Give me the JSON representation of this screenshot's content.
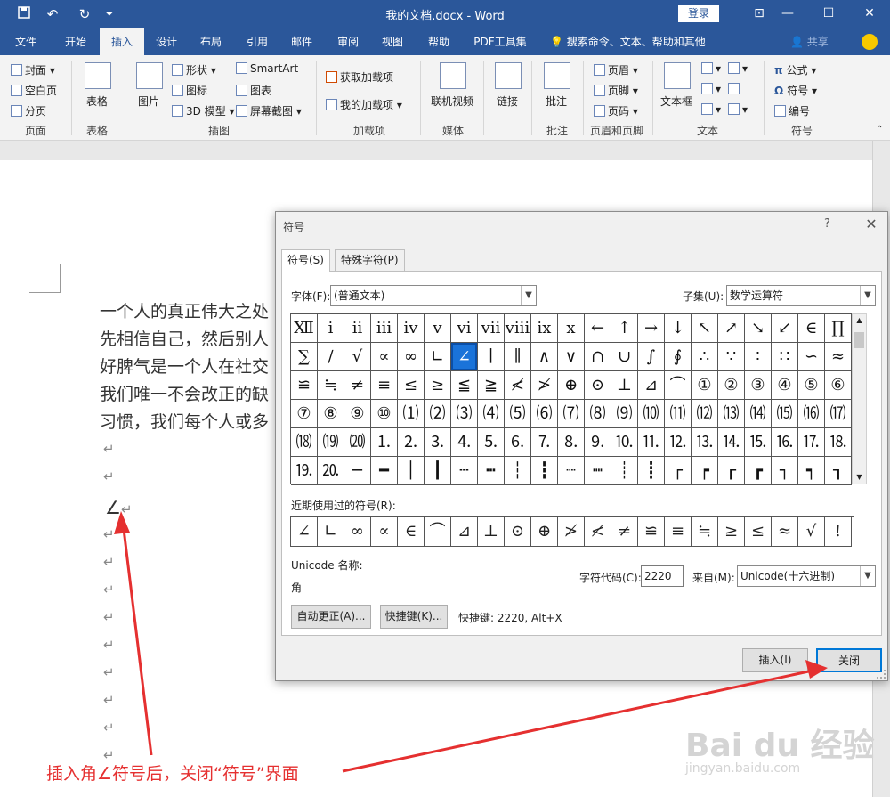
{
  "titlebar": {
    "title": "我的文档.docx  -  Word",
    "login": "登录",
    "save_icon": "save-icon",
    "undo_icon": "undo-icon",
    "redo_icon": "redo-icon",
    "customize_icon": "customize-icon",
    "min": "—",
    "max": "☐",
    "close": "✕",
    "ribbon_toggle": "⊡"
  },
  "menu": {
    "tabs": [
      "文件",
      "开始",
      "插入",
      "设计",
      "布局",
      "引用",
      "邮件",
      "审阅",
      "视图",
      "帮助",
      "PDF工具集"
    ],
    "active_tab": "插入",
    "tell_me": "搜索命令、文本、帮助和其他",
    "share": "共享"
  },
  "ribbon": {
    "pages": {
      "cover": "封面",
      "blank": "空白页",
      "break": "分页",
      "label": "页面"
    },
    "tables": {
      "table": "表格",
      "label": "表格"
    },
    "illustrations": {
      "picture": "图片",
      "shapes": "形状",
      "icons": "图标",
      "models3d": "3D 模型",
      "smartart": "SmartArt",
      "chart": "图表",
      "screenshot": "屏幕截图",
      "label": "插图"
    },
    "addins": {
      "get": "获取加载项",
      "mine": "我的加载项",
      "label": "加载项"
    },
    "media": {
      "video": "联机视频",
      "label": "媒体"
    },
    "links": {
      "link": "链接",
      "label": ""
    },
    "comments": {
      "comment": "批注",
      "label": "批注"
    },
    "headerfooter": {
      "header": "页眉",
      "footer": "页脚",
      "pagenum": "页码",
      "label": "页眉和页脚"
    },
    "text": {
      "textbox": "文本框",
      "label": "文本"
    },
    "symbols": {
      "equation": "公式",
      "symbol": "符号",
      "number": "编号",
      "label": "符号"
    }
  },
  "document": {
    "lines": [
      "一个人的真正伟大之处",
      "先相信自己，然后别人",
      "好脾气是一个人在社交",
      "我们唯一不会改正的缺",
      "习惯，我们每个人或多"
    ],
    "para_mark": "↵",
    "inserted_symbol": "∠",
    "annotation": "插入角∠符号后，关闭“符号”界面",
    "watermark": "Bai du 经验",
    "watermark_url": "jingyan.baidu.com"
  },
  "dialog": {
    "title": "符号",
    "help": "?",
    "close": "✕",
    "tabs": [
      "符号(S)",
      "特殊字符(P)"
    ],
    "font_label": "字体(F):",
    "font_value": "(普通文本)",
    "subset_label": "子集(U):",
    "subset_value": "数学运算符",
    "grid": [
      [
        "Ⅻ",
        "ⅰ",
        "ⅱ",
        "ⅲ",
        "ⅳ",
        "ⅴ",
        "ⅵ",
        "ⅶ",
        "ⅷ",
        "ⅸ",
        "ⅹ",
        "←",
        "↑",
        "→",
        "↓",
        "↖",
        "↗",
        "↘",
        "↙",
        "∈",
        "∏"
      ],
      [
        "∑",
        "∕",
        "√",
        "∝",
        "∞",
        "∟",
        "∠",
        "∣",
        "∥",
        "∧",
        "∨",
        "∩",
        "∪",
        "∫",
        "∮",
        "∴",
        "∵",
        "∶",
        "∷",
        "∽",
        "≈"
      ],
      [
        "≌",
        "≒",
        "≠",
        "≡",
        "≤",
        "≥",
        "≦",
        "≧",
        "≮",
        "≯",
        "⊕",
        "⊙",
        "⊥",
        "⊿",
        "⌒",
        "①",
        "②",
        "③",
        "④",
        "⑤",
        "⑥"
      ],
      [
        "⑦",
        "⑧",
        "⑨",
        "⑩",
        "⑴",
        "⑵",
        "⑶",
        "⑷",
        "⑸",
        "⑹",
        "⑺",
        "⑻",
        "⑼",
        "⑽",
        "⑾",
        "⑿",
        "⒀",
        "⒁",
        "⒂",
        "⒃",
        "⒄"
      ],
      [
        "⒅",
        "⒆",
        "⒇",
        "⒈",
        "⒉",
        "⒊",
        "⒋",
        "⒌",
        "⒍",
        "⒎",
        "⒏",
        "⒐",
        "⒑",
        "⒒",
        "⒓",
        "⒔",
        "⒕",
        "⒖",
        "⒗",
        "⒘",
        "⒙"
      ],
      [
        "⒚",
        "⒛",
        "─",
        "━",
        "│",
        "┃",
        "┄",
        "┅",
        "┆",
        "┇",
        "┈",
        "┉",
        "┊",
        "┋",
        "┌",
        "┍",
        "┎",
        "┏",
        "┐",
        "┑",
        "┒"
      ]
    ],
    "selected": "∠",
    "recent_label": "近期使用过的符号(R):",
    "recent": [
      "∠",
      "∟",
      "∞",
      "∝",
      "∈",
      "⌒",
      "⊿",
      "⊥",
      "⊙",
      "⊕",
      "≯",
      "≮",
      "≠",
      "≌",
      "≡",
      "≒",
      "≥",
      "≤",
      "≈",
      "√",
      "!"
    ],
    "unicode_name_label": "Unicode 名称:",
    "unicode_name": "角",
    "char_code_label": "字符代码(C):",
    "char_code": "2220",
    "from_label": "来自(M):",
    "from_value": "Unicode(十六进制)",
    "autocorrect": "自动更正(A)...",
    "shortcut_key": "快捷键(K)...",
    "shortcut_text": "快捷键: 2220, Alt+X",
    "insert": "插入(I)",
    "close_button": "关闭"
  }
}
